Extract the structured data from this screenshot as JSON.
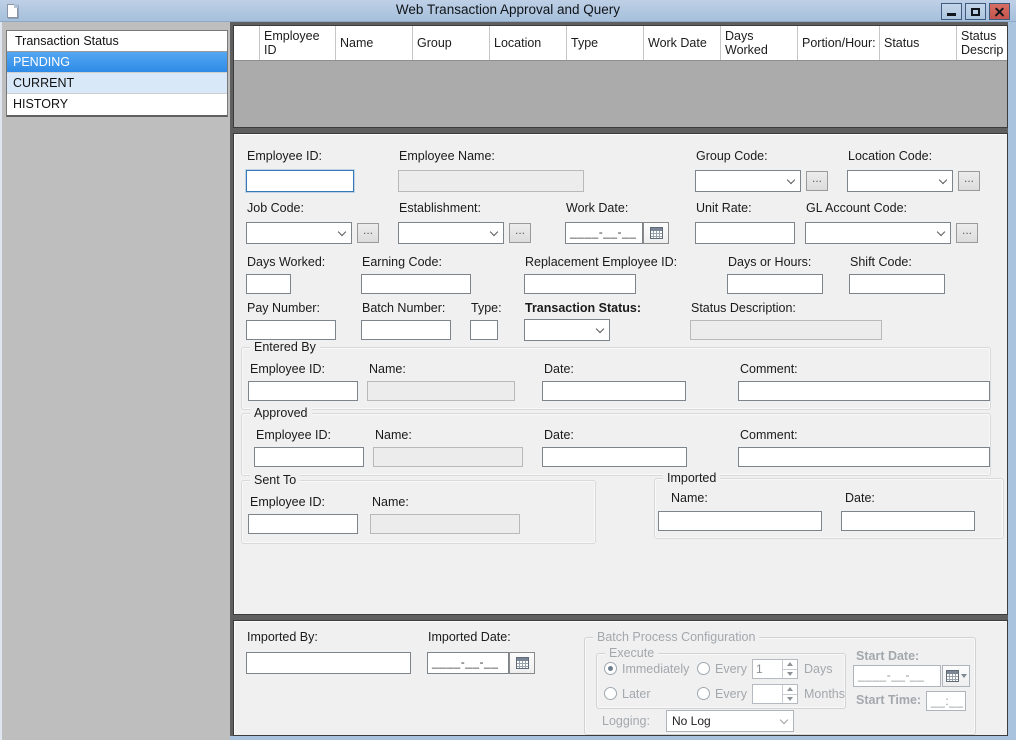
{
  "window": {
    "title": "Web Transaction Approval and Query"
  },
  "sidebar": {
    "header": "Transaction Status",
    "items": [
      {
        "label": "PENDING",
        "state": "selected"
      },
      {
        "label": "CURRENT",
        "state": "highlighted"
      },
      {
        "label": "HISTORY",
        "state": "normal"
      }
    ]
  },
  "table": {
    "columns": [
      "",
      "Employee ID",
      "Name",
      "Group",
      "Location",
      "Type",
      "Work Date",
      "Days Worked",
      "Portion/Hour:",
      "Status",
      "Status Descrip"
    ],
    "rows": []
  },
  "form": {
    "employee_id_label": "Employee ID:",
    "employee_id_value": "",
    "employee_name_label": "Employee Name:",
    "employee_name_value": "",
    "group_code_label": "Group Code:",
    "location_code_label": "Location Code:",
    "job_code_label": "Job Code:",
    "establishment_label": "Establishment:",
    "work_date_label": "Work Date:",
    "work_date_mask": "____-__-__",
    "unit_rate_label": "Unit Rate:",
    "gl_account_code_label": "GL Account Code:",
    "days_worked_label": "Days Worked:",
    "earning_code_label": "Earning Code:",
    "replacement_employee_id_label": "Replacement Employee ID:",
    "days_or_hours_label": "Days or Hours:",
    "shift_code_label": "Shift Code:",
    "pay_number_label": "Pay Number:",
    "batch_number_label": "Batch Number:",
    "type_label": "Type:",
    "transaction_status_label": "Transaction Status:",
    "status_description_label": "Status Description:",
    "entered_by": {
      "title": "Entered By",
      "employee_id_label": "Employee ID:",
      "name_label": "Name:",
      "date_label": "Date:",
      "comment_label": "Comment:"
    },
    "approved": {
      "title": "Approved",
      "employee_id_label": "Employee ID:",
      "name_label": "Name:",
      "date_label": "Date:",
      "comment_label": "Comment:"
    },
    "sent_to": {
      "title": "Sent To",
      "employee_id_label": "Employee ID:",
      "name_label": "Name:"
    },
    "imported": {
      "title": "Imported",
      "name_label": "Name:",
      "date_label": "Date:"
    }
  },
  "bottom": {
    "imported_by_label": "Imported By:",
    "imported_date_label": "Imported Date:",
    "imported_date_mask": "____-__-__",
    "batch": {
      "title": "Batch Process Configuration",
      "execute_title": "Execute",
      "immediately_label": "Immediately",
      "later_label": "Later",
      "every_label": "Every",
      "days_label": "Days",
      "months_label": "Months",
      "every_days_value": "1",
      "every_months_value": "",
      "selected_option": "Immediately",
      "logging_label": "Logging:",
      "logging_value": "No Log",
      "start_date_label": "Start Date:",
      "start_date_mask": "____-__-__",
      "start_time_label": "Start Time:",
      "start_time_mask": "__:__"
    }
  },
  "ui": {
    "browse_label": "...",
    "colors": {
      "titlebar": "#aec6e0",
      "selected_item_blue": "#2e8be6",
      "current_item_blue": "#d8e8f8",
      "close_button_red": "#c4544c",
      "panel_background": "#f0f0f0",
      "grid_body_gray": "#ababab",
      "sidebar_gray": "#bebebe"
    }
  }
}
